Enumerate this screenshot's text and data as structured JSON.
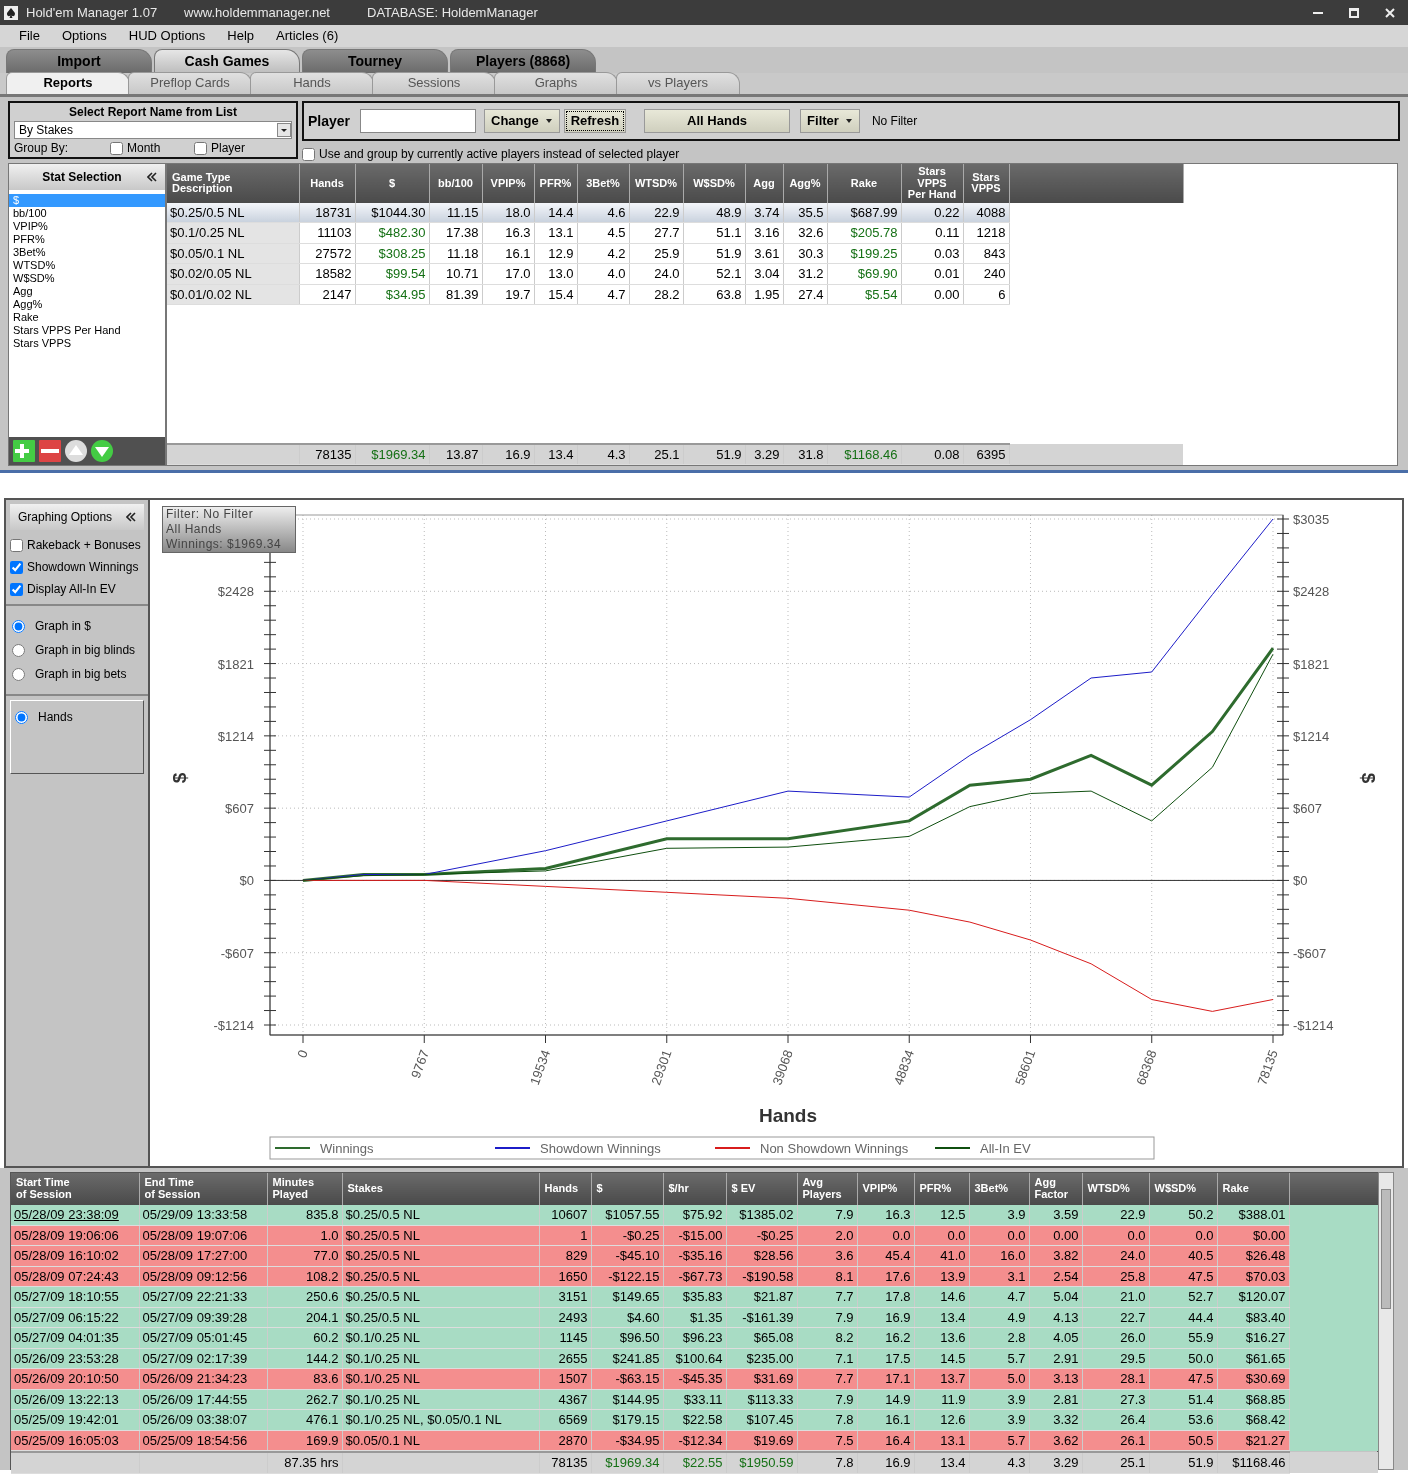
{
  "window": {
    "title": "Hold'em Manager 1.07",
    "website": "www.holdemmanager.net",
    "database": "DATABASE: HoldemManager"
  },
  "menu": [
    "File",
    "Options",
    "HUD Options",
    "Help",
    "Articles (6)"
  ],
  "main_tabs": [
    {
      "label": "Import",
      "selected": false
    },
    {
      "label": "Cash Games",
      "selected": true
    },
    {
      "label": "Tourney",
      "selected": false
    },
    {
      "label": "Players (8868)",
      "selected": false
    }
  ],
  "sub_tabs": [
    {
      "label": "Reports",
      "selected": true
    },
    {
      "label": "Preflop Cards",
      "selected": false
    },
    {
      "label": "Hands",
      "selected": false
    },
    {
      "label": "Sessions",
      "selected": false
    },
    {
      "label": "Graphs",
      "selected": false
    },
    {
      "label": "vs Players",
      "selected": false
    }
  ],
  "report_selector": {
    "title": "Select Report Name from List",
    "value": "By Stakes",
    "group_by_label": "Group By:",
    "options": [
      {
        "label": "Month",
        "checked": false
      },
      {
        "label": "Player",
        "checked": false
      }
    ]
  },
  "player_bar": {
    "label": "Player",
    "buttons": [
      {
        "label": "Change",
        "kind": "dropdown",
        "focused": false
      },
      {
        "label": "Refresh",
        "kind": "plain",
        "focused": true
      },
      {
        "label": "All Hands",
        "kind": "wide",
        "focused": false
      },
      {
        "label": "Filter",
        "kind": "dropdown",
        "focused": false
      }
    ],
    "filter_status": "No Filter",
    "active_players": {
      "label": "Use and group by currently active players instead of selected player",
      "checked": false
    }
  },
  "stat_selection": {
    "title": "Stat Selection",
    "items": [
      {
        "label": "$",
        "selected": true
      },
      {
        "label": "bb/100",
        "selected": false
      },
      {
        "label": "VPIP%",
        "selected": false
      },
      {
        "label": "PFR%",
        "selected": false
      },
      {
        "label": "3Bet%",
        "selected": false
      },
      {
        "label": "WTSD%",
        "selected": false
      },
      {
        "label": "W$SD%",
        "selected": false
      },
      {
        "label": "Agg",
        "selected": false
      },
      {
        "label": "Agg%",
        "selected": false
      },
      {
        "label": "Rake",
        "selected": false
      },
      {
        "label": "Stars VPPS Per Hand",
        "selected": false
      },
      {
        "label": "Stars VPPS",
        "selected": false
      }
    ]
  },
  "stats_table": {
    "columns": [
      {
        "label": "Game Type Description",
        "kind": "text"
      },
      {
        "label": "Hands",
        "kind": "num"
      },
      {
        "label": "$",
        "kind": "money"
      },
      {
        "label": "bb/100",
        "kind": "num"
      },
      {
        "label": "VPIP%",
        "kind": "num"
      },
      {
        "label": "PFR%",
        "kind": "num"
      },
      {
        "label": "3Bet%",
        "kind": "num"
      },
      {
        "label": "WTSD%",
        "kind": "num"
      },
      {
        "label": "W$SD%",
        "kind": "num"
      },
      {
        "label": "Agg",
        "kind": "num"
      },
      {
        "label": "Agg%",
        "kind": "num"
      },
      {
        "label": "Rake",
        "kind": "money"
      },
      {
        "label": "Stars\nVPPS\nPer Hand",
        "kind": "num"
      },
      {
        "label": "Stars\nVPPS",
        "kind": "num"
      }
    ],
    "rows": [
      {
        "selected": true,
        "cells": [
          "$0.25/0.5 NL",
          "18731",
          "$1044.30",
          "11.15",
          "18.0",
          "14.4",
          "4.6",
          "22.9",
          "48.9",
          "3.74",
          "35.5",
          "$687.99",
          "0.22",
          "4088"
        ]
      },
      {
        "selected": false,
        "cells": [
          "$0.1/0.25 NL",
          "11103",
          "$482.30",
          "17.38",
          "16.3",
          "13.1",
          "4.5",
          "27.7",
          "51.1",
          "3.16",
          "32.6",
          "$205.78",
          "0.11",
          "1218"
        ]
      },
      {
        "selected": false,
        "cells": [
          "$0.05/0.1 NL",
          "27572",
          "$308.25",
          "11.18",
          "16.1",
          "12.9",
          "4.2",
          "25.9",
          "51.9",
          "3.61",
          "30.3",
          "$199.25",
          "0.03",
          "843"
        ]
      },
      {
        "selected": false,
        "cells": [
          "$0.02/0.05 NL",
          "18582",
          "$99.54",
          "10.71",
          "17.0",
          "13.0",
          "4.0",
          "24.0",
          "52.1",
          "3.04",
          "31.2",
          "$69.90",
          "0.01",
          "240"
        ]
      },
      {
        "selected": false,
        "cells": [
          "$0.01/0.02 NL",
          "2147",
          "$34.95",
          "81.39",
          "19.7",
          "15.4",
          "4.7",
          "28.2",
          "63.8",
          "1.95",
          "27.4",
          "$5.54",
          "0.00",
          "6"
        ]
      }
    ],
    "totals": [
      {
        "kind": "blank"
      },
      {
        "kind": "value",
        "text": "78135"
      },
      {
        "kind": "value",
        "text": "$1969.34"
      },
      {
        "kind": "value",
        "text": "13.87"
      },
      {
        "kind": "value",
        "text": "16.9"
      },
      {
        "kind": "value",
        "text": "13.4"
      },
      {
        "kind": "value",
        "text": "4.3"
      },
      {
        "kind": "value",
        "text": "25.1"
      },
      {
        "kind": "value",
        "text": "51.9"
      },
      {
        "kind": "value",
        "text": "3.29"
      },
      {
        "kind": "value",
        "text": "31.8"
      },
      {
        "kind": "value",
        "text": "$1168.46"
      },
      {
        "kind": "value",
        "text": "0.08"
      },
      {
        "kind": "value",
        "text": "6395"
      }
    ]
  },
  "graphing_options": {
    "title": "Graphing Options",
    "checkboxes": [
      {
        "label": "Rakeback + Bonuses",
        "checked": false
      },
      {
        "label": "Showdown Winnings",
        "checked": true
      },
      {
        "label": "Display All-In EV",
        "checked": true
      }
    ],
    "units": [
      {
        "label": "Graph in $",
        "selected": true
      },
      {
        "label": "Graph in big blinds",
        "selected": false
      },
      {
        "label": "Graph in big bets",
        "selected": false
      }
    ],
    "axis": [
      {
        "label": "Hands",
        "selected": true
      }
    ]
  },
  "graph": {
    "info": [
      "Filter: No Filter",
      "All Hands",
      "Winnings: $1969.34"
    ],
    "right_axis_labels": [
      "$3035",
      "$2428",
      "$1821",
      "$1214",
      "$607",
      "$0",
      "-$607",
      "-$1214"
    ],
    "ylabel_right": "$",
    "chart_data": {
      "type": "line",
      "xlabel": "Hands",
      "annotations": [
        {
          "text": "$"
        }
      ],
      "x": [
        0,
        4883,
        9767,
        19534,
        29301,
        39068,
        48834,
        53717,
        58601,
        63484,
        68368,
        73251,
        78135
      ],
      "series": [
        {
          "name": "Winnings",
          "color": "#2e6b2e",
          "values": [
            0,
            50,
            50,
            100,
            350,
            350,
            500,
            800,
            850,
            1050,
            800,
            1250,
            1950
          ]
        },
        {
          "name": "Showdown Winnings",
          "color": "#1c1cc8",
          "values": [
            0,
            50,
            50,
            250,
            500,
            750,
            700,
            1050,
            1350,
            1700,
            1750,
            2400,
            3035
          ]
        },
        {
          "name": "Non Showdown Winnings",
          "color": "#d81c1c",
          "values": [
            0,
            0,
            0,
            -50,
            -100,
            -150,
            -250,
            -350,
            -500,
            -700,
            -1000,
            -1100,
            -1000
          ]
        },
        {
          "name": "All-In EV",
          "color": "#0f4f0f",
          "values": [
            0,
            40,
            50,
            80,
            270,
            280,
            370,
            620,
            730,
            750,
            500,
            950,
            1900
          ]
        }
      ],
      "grid": true,
      "legend": true,
      "xlim": [
        0,
        78135
      ],
      "ylim": [
        -1214,
        3035
      ],
      "xticks": [
        0,
        9767,
        19534,
        29301,
        39068,
        48834,
        58601,
        68368,
        78135
      ],
      "yticks": [
        {
          "value": 2428,
          "label": "$2428"
        },
        {
          "value": 1821,
          "label": "$1821"
        },
        {
          "value": 1214,
          "label": "$1214"
        },
        {
          "value": 607,
          "label": "$607"
        },
        {
          "value": 0,
          "label": "$0"
        },
        {
          "value": -607,
          "label": "-$607"
        },
        {
          "value": -1214,
          "label": "-$1214"
        }
      ]
    }
  },
  "sessions_table": {
    "columns": [
      {
        "label": "Start Time\nof Session",
        "kind": "text"
      },
      {
        "label": "End Time\nof Session",
        "kind": "text"
      },
      {
        "label": "Minutes\nPlayed",
        "kind": "num"
      },
      {
        "label": "Stakes",
        "kind": "text"
      },
      {
        "label": "Hands",
        "kind": "num"
      },
      {
        "label": "$",
        "kind": "money"
      },
      {
        "label": "$/hr",
        "kind": "money"
      },
      {
        "label": "$ EV",
        "kind": "money"
      },
      {
        "label": "Avg\nPlayers",
        "kind": "num"
      },
      {
        "label": "VPIP%",
        "kind": "num"
      },
      {
        "label": "PFR%",
        "kind": "num"
      },
      {
        "label": "3Bet%",
        "kind": "num"
      },
      {
        "label": "Agg\nFactor",
        "kind": "num"
      },
      {
        "label": "WTSD%",
        "kind": "num"
      },
      {
        "label": "W$SD%",
        "kind": "num"
      },
      {
        "label": "Rake",
        "kind": "num"
      }
    ],
    "rows": [
      {
        "kind": "win",
        "selected": true,
        "cells": [
          "05/28/09 23:38:09",
          "05/29/09 13:33:58",
          "835.8",
          "$0.25/0.5 NL",
          "10607",
          "$1057.55",
          "$75.92",
          "$1385.02",
          "7.9",
          "16.3",
          "12.5",
          "3.9",
          "3.59",
          "22.9",
          "50.2",
          "$388.01"
        ]
      },
      {
        "kind": "loss",
        "selected": false,
        "cells": [
          "05/28/09 19:06:06",
          "05/28/09 19:07:06",
          "1.0",
          "$0.25/0.5 NL",
          "1",
          "-$0.25",
          "-$15.00",
          "-$0.25",
          "2.0",
          "0.0",
          "0.0",
          "0.0",
          "0.00",
          "0.0",
          "0.0",
          "$0.00"
        ]
      },
      {
        "kind": "loss",
        "selected": false,
        "cells": [
          "05/28/09 16:10:02",
          "05/28/09 17:27:00",
          "77.0",
          "$0.25/0.5 NL",
          "829",
          "-$45.10",
          "-$35.16",
          "$28.56",
          "3.6",
          "45.4",
          "41.0",
          "16.0",
          "3.82",
          "24.0",
          "40.5",
          "$26.48"
        ]
      },
      {
        "kind": "loss",
        "selected": false,
        "cells": [
          "05/28/09 07:24:43",
          "05/28/09 09:12:56",
          "108.2",
          "$0.25/0.5 NL",
          "1650",
          "-$122.15",
          "-$67.73",
          "-$190.58",
          "8.1",
          "17.6",
          "13.9",
          "3.1",
          "2.54",
          "25.8",
          "47.5",
          "$70.03"
        ]
      },
      {
        "kind": "win",
        "selected": false,
        "cells": [
          "05/27/09 18:10:55",
          "05/27/09 22:21:33",
          "250.6",
          "$0.25/0.5 NL",
          "3151",
          "$149.65",
          "$35.83",
          "$21.87",
          "7.7",
          "17.8",
          "14.6",
          "4.7",
          "5.04",
          "21.0",
          "52.7",
          "$120.07"
        ]
      },
      {
        "kind": "win",
        "selected": false,
        "cells": [
          "05/27/09 06:15:22",
          "05/27/09 09:39:28",
          "204.1",
          "$0.25/0.5 NL",
          "2493",
          "$4.60",
          "$1.35",
          "-$161.39",
          "7.9",
          "16.9",
          "13.4",
          "4.9",
          "4.13",
          "22.7",
          "44.4",
          "$83.40"
        ]
      },
      {
        "kind": "win",
        "selected": false,
        "cells": [
          "05/27/09 04:01:35",
          "05/27/09 05:01:45",
          "60.2",
          "$0.1/0.25 NL",
          "1145",
          "$96.50",
          "$96.23",
          "$65.08",
          "8.2",
          "16.2",
          "13.6",
          "2.8",
          "4.05",
          "26.0",
          "55.9",
          "$16.27"
        ]
      },
      {
        "kind": "win",
        "selected": false,
        "cells": [
          "05/26/09 23:53:28",
          "05/27/09 02:17:39",
          "144.2",
          "$0.1/0.25 NL",
          "2655",
          "$241.85",
          "$100.64",
          "$235.00",
          "7.1",
          "17.5",
          "14.5",
          "5.7",
          "2.91",
          "29.5",
          "50.0",
          "$61.65"
        ]
      },
      {
        "kind": "loss",
        "selected": false,
        "cells": [
          "05/26/09 20:10:50",
          "05/26/09 21:34:23",
          "83.6",
          "$0.1/0.25 NL",
          "1507",
          "-$63.15",
          "-$45.35",
          "$31.69",
          "7.7",
          "17.1",
          "13.7",
          "5.0",
          "3.13",
          "28.1",
          "47.5",
          "$30.69"
        ]
      },
      {
        "kind": "win",
        "selected": false,
        "cells": [
          "05/26/09 13:22:13",
          "05/26/09 17:44:55",
          "262.7",
          "$0.1/0.25 NL",
          "4367",
          "$144.95",
          "$33.11",
          "$113.33",
          "7.9",
          "14.9",
          "11.9",
          "3.9",
          "2.81",
          "27.3",
          "51.4",
          "$68.85"
        ]
      },
      {
        "kind": "win",
        "selected": false,
        "cells": [
          "05/25/09 19:42:01",
          "05/26/09 03:38:07",
          "476.1",
          "$0.1/0.25 NL, $0.05/0.1 NL",
          "6569",
          "$179.15",
          "$22.58",
          "$107.45",
          "7.8",
          "16.1",
          "12.6",
          "3.9",
          "3.32",
          "26.4",
          "53.6",
          "$68.42"
        ]
      },
      {
        "kind": "loss",
        "selected": false,
        "cells": [
          "05/25/09 16:05:03",
          "05/25/09 18:54:56",
          "169.9",
          "$0.05/0.1 NL",
          "2870",
          "-$34.95",
          "-$12.34",
          "$19.69",
          "7.5",
          "16.4",
          "13.1",
          "5.7",
          "3.62",
          "26.1",
          "50.5",
          "$21.27"
        ]
      }
    ],
    "totals": [
      {
        "kind": "blank"
      },
      {
        "kind": "blank"
      },
      {
        "kind": "value",
        "text": "87.35 hrs"
      },
      {
        "kind": "blank"
      },
      {
        "kind": "value",
        "text": "78135"
      },
      {
        "kind": "value",
        "text": "$1969.34"
      },
      {
        "kind": "value",
        "text": "$22.55"
      },
      {
        "kind": "value",
        "text": "$1950.59"
      },
      {
        "kind": "value",
        "text": "7.8"
      },
      {
        "kind": "value",
        "text": "16.9"
      },
      {
        "kind": "value",
        "text": "13.4"
      },
      {
        "kind": "value",
        "text": "4.3"
      },
      {
        "kind": "value",
        "text": "3.29"
      },
      {
        "kind": "value",
        "text": "25.1"
      },
      {
        "kind": "value",
        "text": "51.9"
      },
      {
        "kind": "value",
        "text": "$1168.46"
      }
    ]
  }
}
